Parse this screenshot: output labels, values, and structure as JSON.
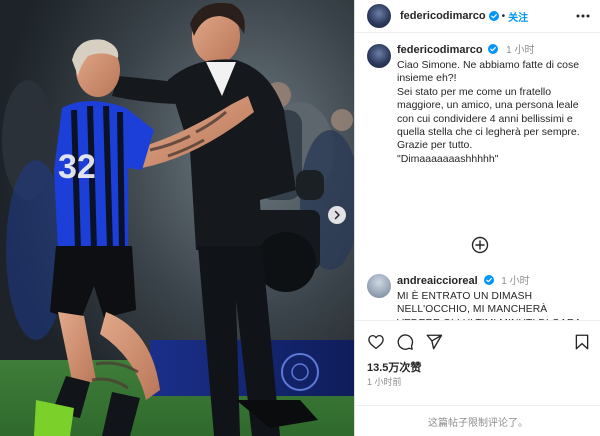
{
  "post": {
    "author": "federicodimarco",
    "follow_label": "关注",
    "dot": "•",
    "more_icon": "more-horizontal-icon"
  },
  "caption": {
    "username": "federicodimarco",
    "time": "1 小时",
    "lines": [
      "Ciao Simone. Ne abbiamo fatte di cose insieme eh?!",
      "Sei stato per me come un fratello maggiore, un amico, una persona leale con cui condividere 4 anni bellissimi e quella stella che ci legherà per sempre.",
      "Grazie per tutto.",
      "\"Dimaaaaaaashhhhh\""
    ]
  },
  "comment": {
    "username": "andreaiccioreal",
    "time": "1 小时",
    "text": "MI È ENTRATO UN DIMASH NELL'OCCHIO, MI MANCHERÀ VEDERE GLI ULTIMI MINUTI DI GARA VOI DUE IN PIEDI A MOTIVARE LA SQUADRA! SI VEDE CHE TRA VOI"
  },
  "actions": {
    "like_icon": "heart-icon",
    "comment_icon": "comment-icon",
    "share_icon": "share-icon",
    "save_icon": "bookmark-icon",
    "likes": "13.5万次赞",
    "time_ago": "1 小时前",
    "comments_disabled": "这篇帖子限制评论了。"
  },
  "colors": {
    "link_blue": "#0095f6",
    "secondary_text": "#8e8e8e",
    "inter_blue": "#1c3fd9",
    "pitch_green": "#3f7d3a"
  }
}
